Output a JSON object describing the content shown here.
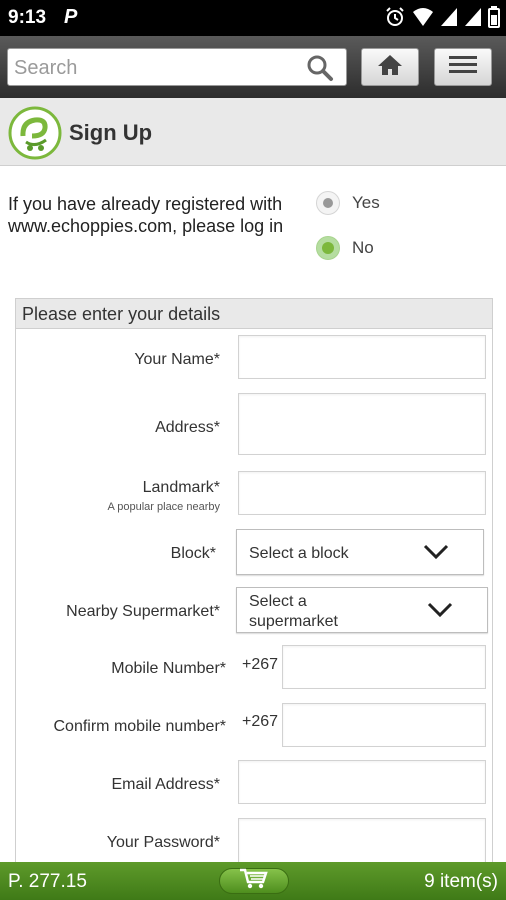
{
  "status_bar": {
    "time": "9:13",
    "notification": "P"
  },
  "toolbar": {
    "search_placeholder": "Search"
  },
  "header": {
    "title": "Sign Up"
  },
  "registered": {
    "question": "If you have already registered with www.echoppies.com, please log in",
    "options": [
      {
        "label": "Yes",
        "selected": false
      },
      {
        "label": "No",
        "selected": true
      }
    ]
  },
  "details": {
    "heading": "Please enter your details",
    "fields": {
      "name": {
        "label": "Your Name*"
      },
      "address": {
        "label": "Address*"
      },
      "landmark": {
        "label": "Landmark*",
        "hint": "A popular place nearby"
      },
      "block": {
        "label": "Block*",
        "value": "Select a block"
      },
      "supermarket": {
        "label": "Nearby Supermarket*",
        "value_line1": "Select a",
        "value_line2": "supermarket"
      },
      "mobile": {
        "label": "Mobile Number*",
        "prefix": "+267"
      },
      "confirm_mobile": {
        "label": "Confirm mobile number*",
        "prefix": "+267"
      },
      "email": {
        "label": "Email Address*"
      },
      "password": {
        "label": "Your Password*"
      }
    }
  },
  "bottom_bar": {
    "price": "P. 277.15",
    "items": "9 item(s)"
  },
  "colors": {
    "accent_green": "#7cb83c",
    "toolbar_dark": "#2d2d2d",
    "bottom_green": "#4e8e1e"
  }
}
